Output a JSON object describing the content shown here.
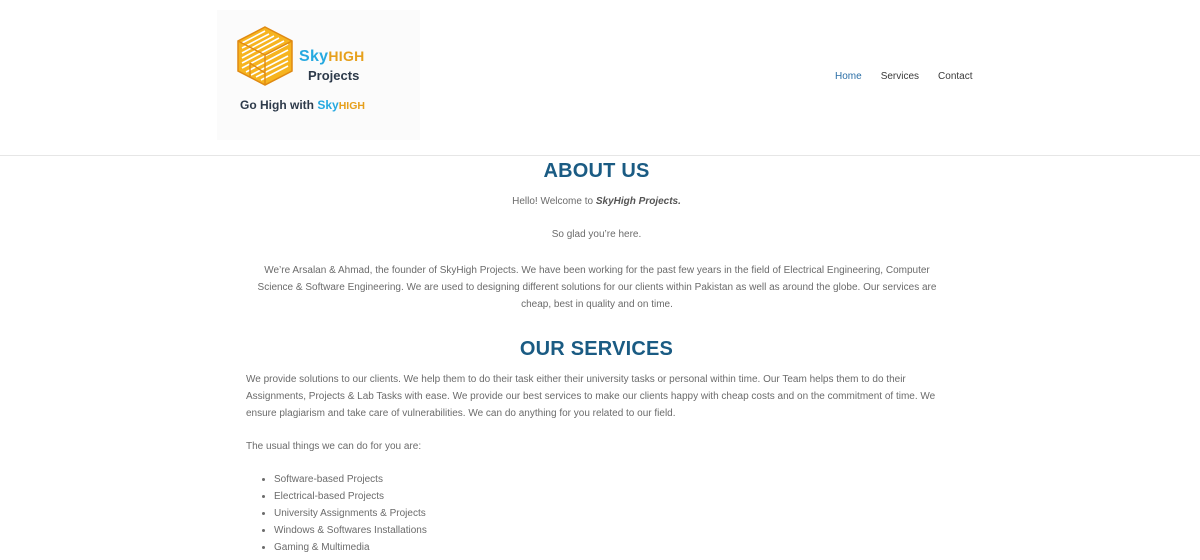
{
  "brand": {
    "name_sky": "Sky",
    "name_high": "HIGH",
    "name_line2": "Projects",
    "tagline_prefix": "Go High with ",
    "tagline_sky": "Sky",
    "tagline_high": "HIGH",
    "colors": {
      "sky": "#26a9e0",
      "high": "#e6a01c",
      "dark": "#2d3a4a"
    }
  },
  "nav": {
    "items": [
      {
        "label": "Home",
        "active": true
      },
      {
        "label": "Services",
        "active": false
      },
      {
        "label": "Contact",
        "active": false
      }
    ],
    "active_color": "#2a6ea6"
  },
  "about": {
    "title": "ABOUT US",
    "hello_prefix": "Hello!  Welcome to ",
    "hello_brand": "SkyHigh Projects.",
    "glad": "So glad you’re here.",
    "intro": "We’re Arsalan & Ahmad, the founder of SkyHigh Projects. We have been working for the past few years in the field of Electrical Engineering, Computer Science & Software Engineering. We are used to designing different solutions for our clients within Pakistan as well as around the globe. Our services are cheap, best in quality and on time."
  },
  "services": {
    "title": "OUR SERVICES",
    "description": "We provide solutions to our clients. We help them to do their task either their university tasks or personal within time. Our Team helps them to do their Assignments, Projects & Lab Tasks with ease. We provide our best services to make our clients happy with cheap costs and on the commitment of time. We ensure plagiarism and take care of vulnerabilities. We can do anything for you related to our field.",
    "usual_intro": "The usual things we can do for you are:",
    "items": [
      "Software-based Projects",
      "Electrical-based Projects",
      "University Assignments & Projects",
      "Windows & Softwares Installations",
      "Gaming & Multimedia"
    ]
  },
  "theme": {
    "heading_color": "#1a5b83",
    "text_color": "#6b6b6b"
  }
}
